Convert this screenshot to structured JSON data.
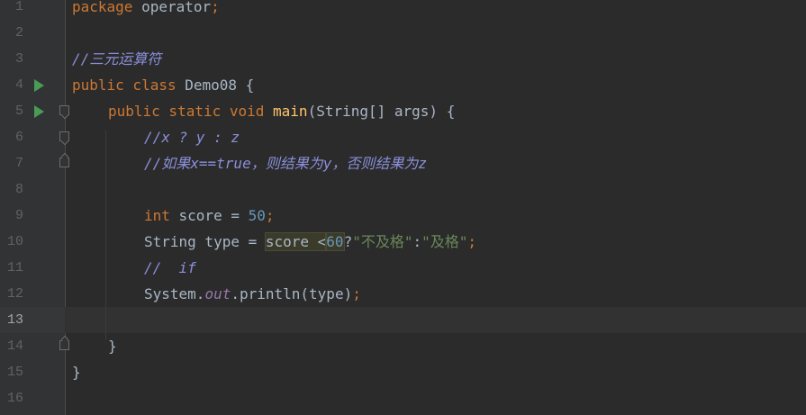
{
  "editor": {
    "current_line": "13",
    "lines": [
      {
        "num": "1",
        "tokens": [
          {
            "t": "package",
            "c": "kw"
          },
          {
            "t": " operator",
            "c": "plain"
          },
          {
            "t": ";",
            "c": "kw"
          }
        ]
      },
      {
        "num": "2",
        "tokens": []
      },
      {
        "num": "3",
        "tokens": [
          {
            "t": "//三元运算符",
            "c": "cm"
          }
        ]
      },
      {
        "num": "4",
        "tokens": [
          {
            "t": "public class ",
            "c": "kw"
          },
          {
            "t": "Demo08 {",
            "c": "plain"
          }
        ]
      },
      {
        "num": "5",
        "tokens": [
          {
            "t": "public static void ",
            "c": "kw"
          },
          {
            "t": "main",
            "c": "fn"
          },
          {
            "t": "(String[] args) {",
            "c": "plain"
          }
        ]
      },
      {
        "num": "6",
        "tokens": [
          {
            "t": "//x ? y : z",
            "c": "cm"
          }
        ]
      },
      {
        "num": "7",
        "tokens": [
          {
            "t": "//如果x==true，则结果为y，否则结果为z",
            "c": "cm"
          }
        ]
      },
      {
        "num": "8",
        "tokens": []
      },
      {
        "num": "9",
        "tokens": [
          {
            "t": "int ",
            "c": "kw"
          },
          {
            "t": "score = ",
            "c": "plain"
          },
          {
            "t": "50",
            "c": "num"
          },
          {
            "t": ";",
            "c": "kw"
          }
        ]
      },
      {
        "num": "10",
        "tokens": [
          {
            "t": "String type = ",
            "c": "plain"
          },
          {
            "t": "score <",
            "c": "plain",
            "hl": true
          },
          {
            "t": "60",
            "c": "num",
            "hl": true
          },
          {
            "t": "?",
            "c": "plain"
          },
          {
            "t": "\"不及格\"",
            "c": "str"
          },
          {
            "t": ":",
            "c": "plain"
          },
          {
            "t": "\"及格\"",
            "c": "str"
          },
          {
            "t": ";",
            "c": "kw"
          }
        ]
      },
      {
        "num": "11",
        "tokens": [
          {
            "t": "//  if",
            "c": "cm"
          }
        ]
      },
      {
        "num": "12",
        "tokens": [
          {
            "t": "System.",
            "c": "plain"
          },
          {
            "t": "out",
            "c": "fld"
          },
          {
            "t": ".println(type)",
            "c": "plain"
          },
          {
            "t": ";",
            "c": "kw"
          }
        ]
      },
      {
        "num": "13",
        "tokens": []
      },
      {
        "num": "14",
        "tokens": [
          {
            "t": "}",
            "c": "plain"
          }
        ]
      },
      {
        "num": "15",
        "tokens": [
          {
            "t": "}",
            "c": "plain"
          }
        ]
      },
      {
        "num": "16",
        "tokens": []
      }
    ]
  },
  "icons": {
    "run": "run-triangle-icon",
    "fold_open": "fold-open-icon",
    "fold_close": "fold-close-icon"
  },
  "colors": {
    "background": "#2b2b2b",
    "gutter": "#313335",
    "keyword": "#cc7832",
    "comment": "#8a8fda",
    "function": "#ffc66d",
    "number": "#6897bb",
    "string": "#6a8759",
    "field": "#9876aa",
    "text": "#a9b7c6",
    "run_icon": "#499c54"
  }
}
